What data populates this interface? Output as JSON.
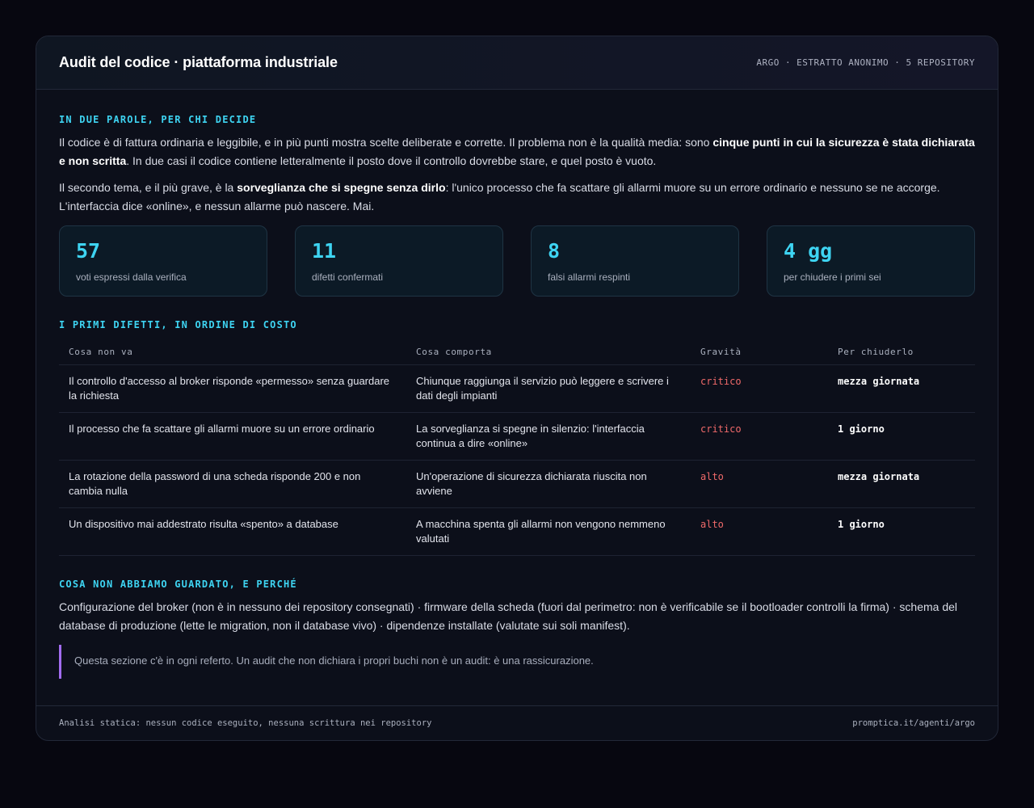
{
  "header": {
    "title": "Audit del codice · piattaforma industriale",
    "meta": "ARGO · ESTRATTO ANONIMO · 5 REPOSITORY"
  },
  "summary": {
    "title": "In due parole, per chi decide",
    "p1_a": "Il codice è di fattura ordinaria e leggibile, e in più punti mostra scelte deliberate e corrette. Il problema non è la qualità media: sono ",
    "p1_b": "cinque punti in cui la sicurezza è stata dichiarata e non scritta",
    "p1_c": ". In due casi il codice contiene letteralmente il posto dove il controllo dovrebbe stare, e quel posto è vuoto.",
    "p2_a": "Il secondo tema, e il più grave, è la ",
    "p2_b": "sorveglianza che si spegne senza dirlo",
    "p2_c": ": l'unico processo che fa scattare gli allarmi muore su un errore ordinario e nessuno se ne accorge. L'interfaccia dice «online», e nessun allarme può nascere. Mai."
  },
  "stats": [
    {
      "value": "57",
      "label": "voti espressi dalla verifica"
    },
    {
      "value": "11",
      "label": "difetti confermati"
    },
    {
      "value": "8",
      "label": "falsi allarmi respinti"
    },
    {
      "value": "4 gg",
      "label": "per chiudere i primi sei"
    }
  ],
  "defects": {
    "title": "I primi difetti, in ordine di costo",
    "columns": [
      "Cosa non va",
      "Cosa comporta",
      "Gravità",
      "Per chiuderlo"
    ],
    "rows": [
      [
        "Il controllo d'accesso al broker risponde «permesso» senza guardare la richiesta",
        "Chiunque raggiunga il servizio può leggere e scrivere i dati degli impianti",
        "critico",
        "mezza giornata"
      ],
      [
        "Il processo che fa scattare gli allarmi muore su un errore ordinario",
        "La sorveglianza si spegne in silenzio: l'interfaccia continua a dire «online»",
        "critico",
        "1 giorno"
      ],
      [
        "La rotazione della password di una scheda risponde 200 e non cambia nulla",
        "Un'operazione di sicurezza dichiarata riuscita non avviene",
        "alto",
        "mezza giornata"
      ],
      [
        "Un dispositivo mai addestrato risulta «spento» a database",
        "A macchina spenta gli allarmi non vengono nemmeno valutati",
        "alto",
        "1 giorno"
      ]
    ]
  },
  "exclusions": {
    "title": "Cosa non abbiamo guardato, e perché",
    "text": "Configurazione del broker (non è in nessuno dei repository consegnati) · firmware della scheda (fuori dal perimetro: non è verificabile se il bootloader controlli la firma) · schema del database di produzione (lette le migration, non il database vivo) · dipendenze installate (valutate sui soli manifest).",
    "quote": "Questa sezione c'è in ogni referto. Un audit che non dichiara i propri buchi non è un audit: è una rassicurazione."
  },
  "footer": {
    "left": "Analisi statica: nessun codice eseguito, nessuna scrittura nei repository",
    "right": "promptica.it/agenti/argo"
  }
}
